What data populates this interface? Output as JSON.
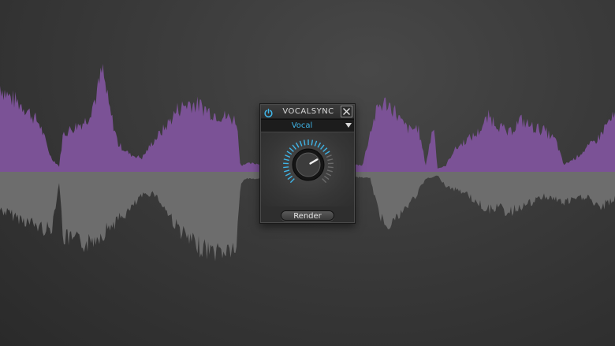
{
  "plugin": {
    "title": "VOCALSYNC",
    "preset": {
      "selected": "Vocal"
    },
    "knob": {
      "value_fraction": 0.72
    },
    "render_label": "Render"
  },
  "colors": {
    "accent": "#3fb4e6",
    "waveform_upper": "#7b5296",
    "waveform_lower": "#6d6d6d",
    "background": "#3a3a3a"
  },
  "icons": {
    "power": "power-icon",
    "close": "close-icon",
    "dropdown": "chevron-down-icon"
  }
}
